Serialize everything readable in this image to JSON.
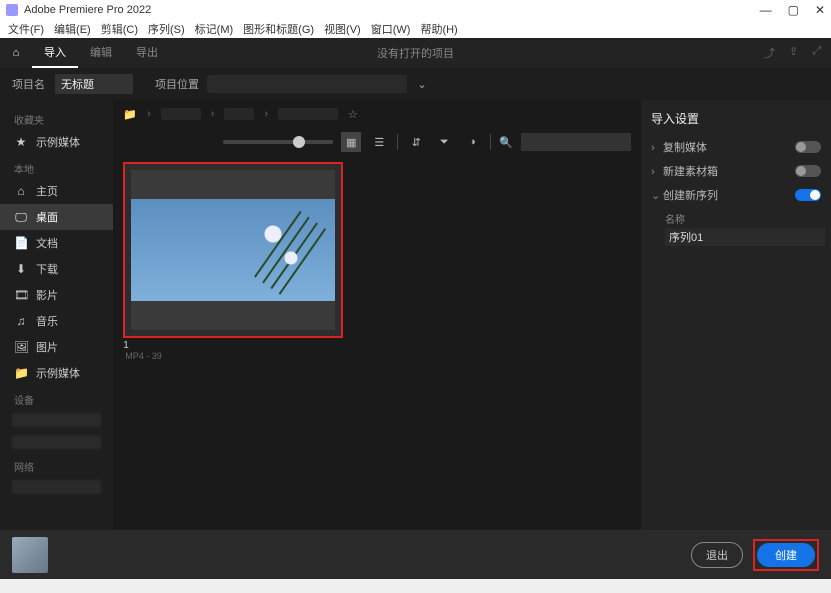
{
  "window": {
    "title": "Adobe Premiere Pro 2022",
    "min": "—",
    "max": "▢",
    "close": "✕"
  },
  "menus": [
    "文件(F)",
    "编辑(E)",
    "剪辑(C)",
    "序列(S)",
    "标记(M)",
    "图形和标题(G)",
    "视图(V)",
    "窗口(W)",
    "帮助(H)"
  ],
  "modes": {
    "home": "⌂",
    "import": "导入",
    "edit": "编辑",
    "export": "导出",
    "center_title": "没有打开的项目"
  },
  "fields": {
    "name_label": "项目名",
    "name_value": "无标题",
    "location_label": "项目位置",
    "chevron": "⌄"
  },
  "sidebar": {
    "fav_section": "收藏夹",
    "fav_item": "示例媒体",
    "local_section": "本地",
    "items": [
      {
        "icon": "⌂",
        "label": "主页"
      },
      {
        "icon": "🖵",
        "label": "桌面"
      },
      {
        "icon": "📄",
        "label": "文档"
      },
      {
        "icon": "⬇",
        "label": "下载"
      },
      {
        "icon": "🎞",
        "label": "影片"
      },
      {
        "icon": "♫",
        "label": "音乐"
      },
      {
        "icon": "🖼",
        "label": "图片"
      },
      {
        "icon": "📁",
        "label": "示例媒体"
      }
    ],
    "device_section": "设备",
    "net_section": "网络"
  },
  "center": {
    "star": "☆",
    "grid_icon": "▦",
    "list_icon": "☰",
    "sort_icon": "⇵",
    "filter_icon": "⏷",
    "eye_icon": "◑",
    "search_icon": "🔍",
    "media_name": "1",
    "media_type": "MP4 - 39"
  },
  "right": {
    "header": "导入设置",
    "opt_copy": "复制媒体",
    "opt_newbin": "新建素材箱",
    "opt_newseq": "创建新序列",
    "name_label": "名称",
    "seq_name": "序列01"
  },
  "footer": {
    "exit": "退出",
    "create": "创建"
  }
}
